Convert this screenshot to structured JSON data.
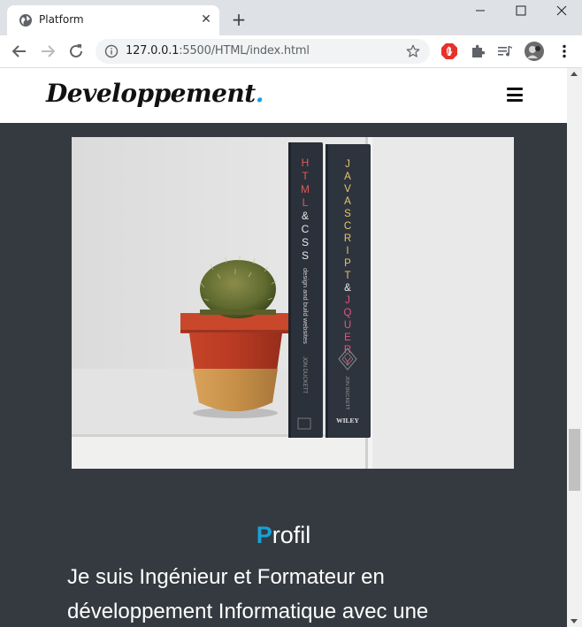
{
  "browser": {
    "tab_title": "Platform",
    "new_tab": "+",
    "close": "✕",
    "url_host": "127.0.0.1",
    "url_rest": ":5500/HTML/index.html",
    "icons": [
      "globe-icon",
      "close-icon",
      "minimize-icon",
      "maximize-icon",
      "window-close-icon",
      "back-icon",
      "forward-icon",
      "reload-icon",
      "info-icon",
      "star-icon",
      "adblock-icon",
      "extensions-icon",
      "media-icon",
      "profile-avatar",
      "kebab-menu-icon"
    ]
  },
  "site": {
    "brand": "Developpement",
    "brand_dot": ".",
    "accent_color": "#17a2d8",
    "background_color": "#343a40",
    "hero_image": {
      "book1_spine_title": "HTML & CSS",
      "book1_subtitle": "design and build websites",
      "book1_author": "JON DUCKETT",
      "book2_spine_title": "JAVASCRIPT & JQUERY",
      "book2_author": "JON DUCKETT",
      "book2_publisher": "WILEY"
    },
    "profile": {
      "title_first": "P",
      "title_rest": "rofil",
      "text": "Je suis Ingénieur et Formateur en développement Informatique avec une"
    }
  }
}
